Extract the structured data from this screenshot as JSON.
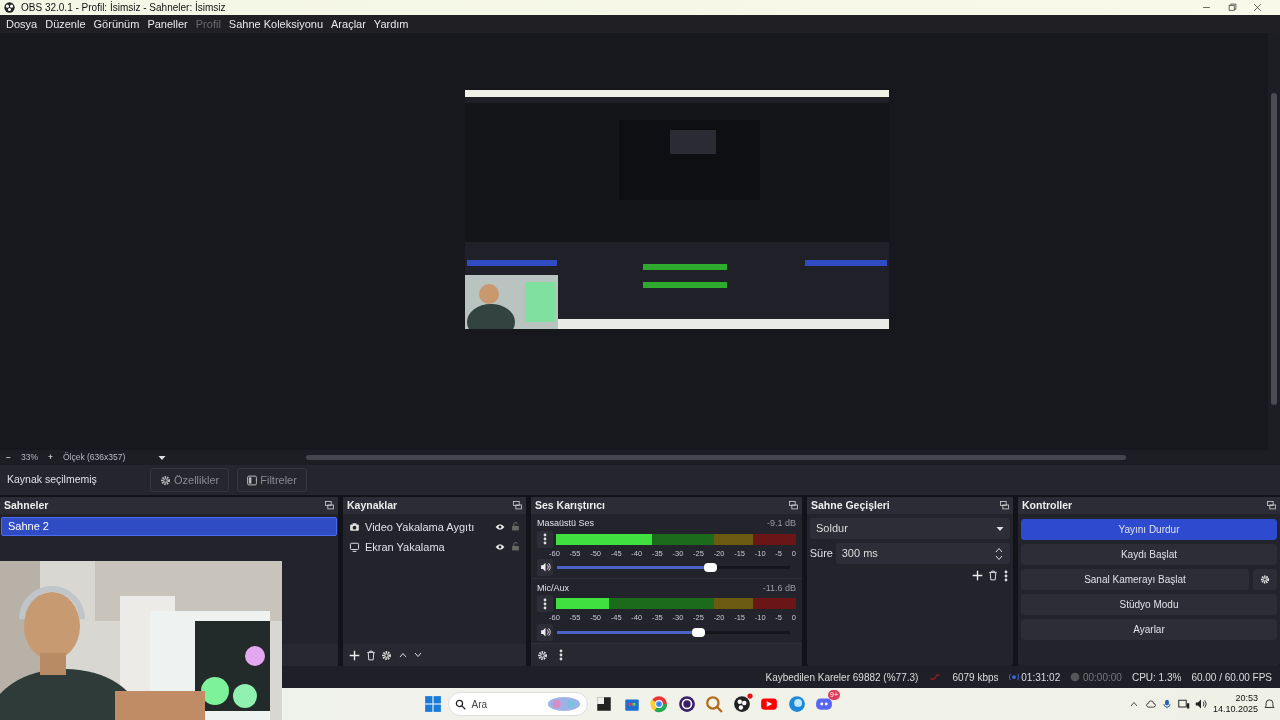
{
  "window": {
    "title": "OBS 32.0.1 - Profil: İsimsiz - Sahneler: İsimsiz"
  },
  "menu": [
    {
      "label": "Dosya",
      "disabled": false
    },
    {
      "label": "Düzenle",
      "disabled": false
    },
    {
      "label": "Görünüm",
      "disabled": false
    },
    {
      "label": "Paneller",
      "disabled": false
    },
    {
      "label": "Profil",
      "disabled": true
    },
    {
      "label": "Sahne Koleksiyonu",
      "disabled": false
    },
    {
      "label": "Araçlar",
      "disabled": false
    },
    {
      "label": "Yardım",
      "disabled": false
    }
  ],
  "zoom_bar": {
    "minus": "−",
    "percent": "33%",
    "plus": "+",
    "scale": "Ölçek (636x357)"
  },
  "source_toolbar": {
    "status": "Kaynak seçilmemiş",
    "buttons": [
      {
        "label": "Özellikler",
        "kind": "properties"
      },
      {
        "label": "Filtreler",
        "kind": "filters"
      }
    ]
  },
  "scenes": {
    "title": "Sahneler",
    "items": [
      {
        "label": "Sahne 2",
        "selected": true
      }
    ]
  },
  "sources": {
    "title": "Kaynaklar",
    "items": [
      {
        "label": "Video Yakalama Aygıtı",
        "kind": "camera",
        "visible": true
      },
      {
        "label": "Ekran Yakalama",
        "kind": "display",
        "visible": true
      }
    ]
  },
  "mixer": {
    "title": "Ses Karıştırıcı",
    "channels": [
      {
        "name": "Masaüstü Ses",
        "reading": "-9.1 dB",
        "meter": {
          "level": 0.4
        },
        "fader": {
          "level": 0.66
        },
        "ticks": [
          "-60",
          "-55",
          "-50",
          "-45",
          "-40",
          "-35",
          "-30",
          "-25",
          "-20",
          "-15",
          "-10",
          "-5",
          "0"
        ]
      },
      {
        "name": "Mic/Aux",
        "reading": "-11.6 dB",
        "meter": {
          "level": 0.22
        },
        "fader": {
          "level": 0.61
        },
        "ticks": [
          "-60",
          "-55",
          "-50",
          "-45",
          "-40",
          "-35",
          "-30",
          "-25",
          "-20",
          "-15",
          "-10",
          "-5",
          "0"
        ]
      }
    ]
  },
  "transitions": {
    "title": "Sahne Geçişleri",
    "selected": "Soldur",
    "duration_label": "Süre",
    "duration": "300 ms"
  },
  "controls": {
    "title": "Kontroller",
    "buttons": [
      {
        "label": "Yayını Durdur",
        "active": true,
        "settings": false
      },
      {
        "label": "Kaydı Başlat",
        "active": false,
        "settings": false
      },
      {
        "label": "Sanal Kamerayı Başlat",
        "active": false,
        "settings": true
      },
      {
        "label": "Stüdyo Modu",
        "active": false,
        "settings": false
      },
      {
        "label": "Ayarlar",
        "active": false,
        "settings": false
      }
    ]
  },
  "status_bar": {
    "dropped_frames": "Kaybedilen Kareler 69882 (%77.3)",
    "bitrate": "6079 kbps",
    "stream_time": "01:31:02",
    "record_time": "00:00:00",
    "cpu": "CPU: 1.3%",
    "fps": "60.00 / 60.00 FPS"
  },
  "taskbar": {
    "search_placeholder": "Ara",
    "badge": "9+",
    "time": "20:53",
    "date": "14.10.2025"
  }
}
